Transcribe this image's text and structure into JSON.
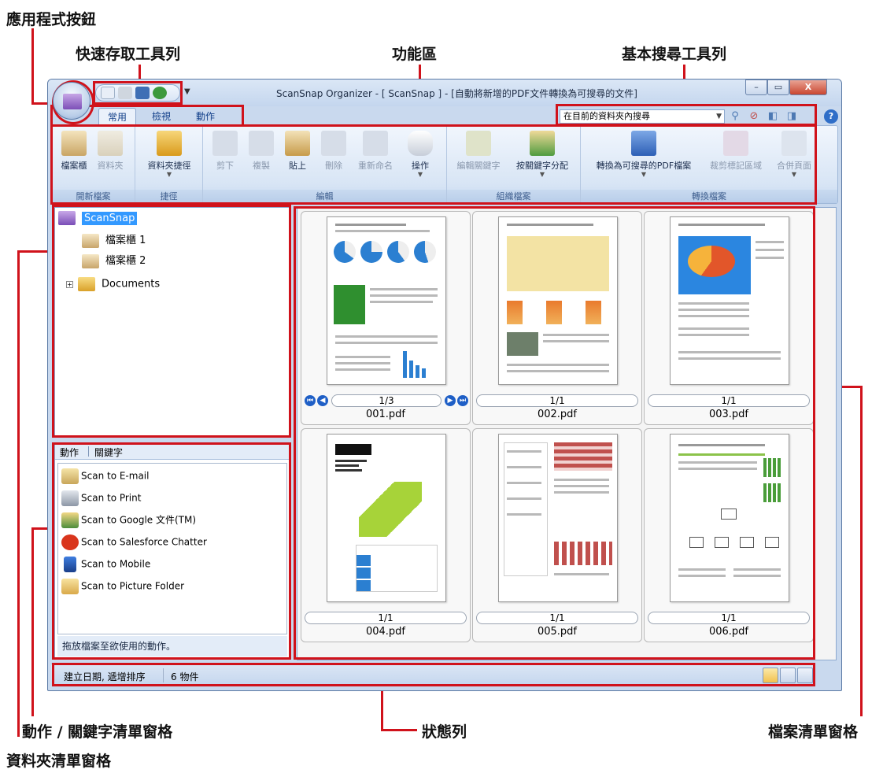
{
  "callouts": {
    "app_button": "應用程式按鈕",
    "quick_access": "快速存取工具列",
    "ribbon": "功能區",
    "search_toolbar": "基本搜尋工具列",
    "action_pane": "動作 / 關鍵字清單窗格",
    "status_bar": "狀態列",
    "file_pane": "檔案清單窗格",
    "folder_pane": "資料夾清單窗格"
  },
  "window": {
    "title": "ScanSnap Organizer - [ ScanSnap ] - [自動將新增的PDF文件轉換為可搜尋的文件]",
    "controls": {
      "minimize": "–",
      "maximize": "▭",
      "close": "X"
    }
  },
  "tabs": [
    "常用",
    "檢視",
    "動作"
  ],
  "search": {
    "scope": "在目前的資料夾內搜尋"
  },
  "ribbon": {
    "groups": [
      {
        "label": "開新檔案",
        "buttons": [
          "檔案櫃",
          "資料夾"
        ]
      },
      {
        "label": "捷徑",
        "buttons": [
          "資料夾捷徑"
        ]
      },
      {
        "label": "編輯",
        "buttons": [
          "剪下",
          "複製",
          "貼上",
          "刪除",
          "重新命名",
          "操作"
        ]
      },
      {
        "label": "組織檔案",
        "buttons": [
          "編輯關鍵字",
          "按關鍵字分配"
        ]
      },
      {
        "label": "轉換檔案",
        "buttons": [
          "轉換為可搜尋的PDF檔案",
          "裁剪標記區域",
          "合併頁面"
        ]
      }
    ]
  },
  "folder_tree": {
    "root": "ScanSnap",
    "children": [
      "檔案櫃 1",
      "檔案櫃 2",
      "Documents"
    ]
  },
  "action_pane": {
    "tabs": [
      "動作",
      "關鍵字"
    ],
    "items": [
      "Scan to E-mail",
      "Scan to Print",
      "Scan to Google 文件(TM)",
      "Scan to Salesforce Chatter",
      "Scan to Mobile",
      "Scan to Picture Folder"
    ],
    "hint": "拖放檔案至欲使用的動作。"
  },
  "files": [
    {
      "name": "001.pdf",
      "page": "1/3"
    },
    {
      "name": "002.pdf",
      "page": "1/1"
    },
    {
      "name": "003.pdf",
      "page": "1/1"
    },
    {
      "name": "004.pdf",
      "page": "1/1"
    },
    {
      "name": "005.pdf",
      "page": "1/1"
    },
    {
      "name": "006.pdf",
      "page": "1/1"
    }
  ],
  "status": {
    "sort": "建立日期, 遞增排序",
    "count": "6 物件"
  },
  "colors": {
    "callout_red": "#d0121b",
    "selection": "#3399ff"
  }
}
